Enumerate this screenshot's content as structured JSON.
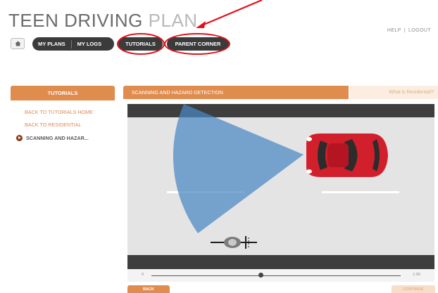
{
  "header": {
    "title_part1": "TEEN DRIVING",
    "title_part2": "PLAN",
    "help": "HELP",
    "separator": "|",
    "logout": "LOGOUT"
  },
  "nav": {
    "home_icon": "home-icon",
    "items": [
      "MY PLANS",
      "MY LOGS",
      "TUTORIALS",
      "PARENT CORNER"
    ]
  },
  "sidebar": {
    "heading": "TUTORIALS",
    "links": [
      "BACK TO TUTORIALS HOME",
      "BACK TO RESIDENTIAL"
    ],
    "current": "SCANNING AND HAZAR..."
  },
  "content": {
    "heading": "SCANNING AND HAZARD DETECTION",
    "side_tab": "What is Residential?"
  },
  "player": {
    "time_start": "0",
    "time_end": "1:00",
    "progress": 0.44
  },
  "buttons": {
    "back": "BACK",
    "continue": "CONTINUE"
  },
  "colors": {
    "accent": "#e08c4e",
    "car": "#d21f2c",
    "annotation": "#e3101a",
    "vision_cone": "#4a87c4"
  }
}
